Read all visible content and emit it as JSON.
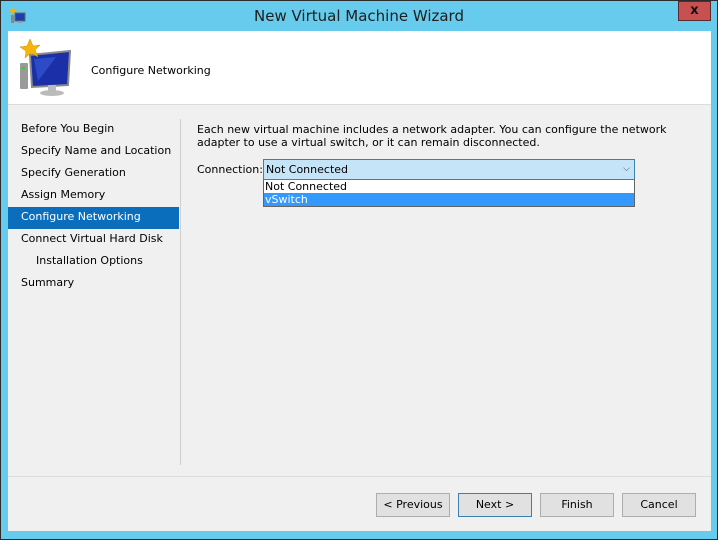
{
  "window": {
    "title": "New Virtual Machine Wizard",
    "close_label": "x"
  },
  "header": {
    "title": "Configure Networking"
  },
  "nav": {
    "items": [
      {
        "label": "Before You Begin"
      },
      {
        "label": "Specify Name and Location"
      },
      {
        "label": "Specify Generation"
      },
      {
        "label": "Assign Memory"
      },
      {
        "label": "Configure Networking"
      },
      {
        "label": "Connect Virtual Hard Disk"
      },
      {
        "label": "Installation Options"
      },
      {
        "label": "Summary"
      }
    ],
    "active": "Configure Networking"
  },
  "main": {
    "description": "Each new virtual machine includes a network adapter. You can configure the network adapter to use a virtual switch, or it can remain disconnected.",
    "connection_label": "Connection:",
    "connection_value": "Not Connected",
    "options": [
      {
        "label": "Not Connected"
      },
      {
        "label": "vSwitch"
      }
    ],
    "highlighted_option": "vSwitch"
  },
  "buttons": {
    "previous": "< Previous",
    "next": "Next >",
    "finish": "Finish",
    "cancel": "Cancel"
  }
}
